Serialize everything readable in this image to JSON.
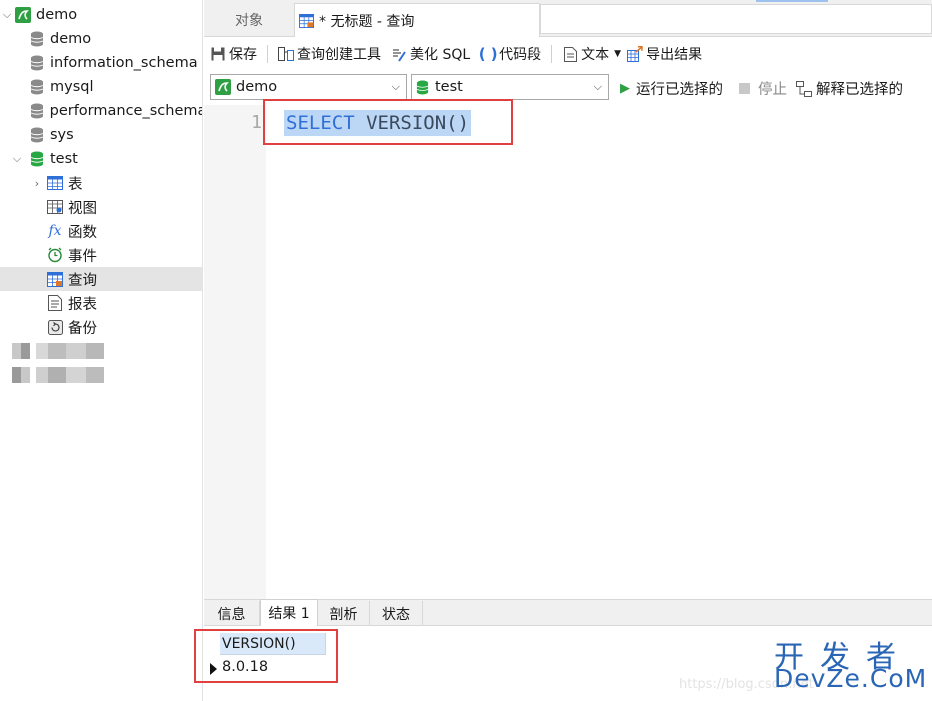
{
  "sidebar": {
    "connection": {
      "label": "demo"
    },
    "databases": [
      {
        "label": "demo"
      },
      {
        "label": "information_schema"
      },
      {
        "label": "mysql"
      },
      {
        "label": "performance_schema"
      },
      {
        "label": "sys"
      },
      {
        "label": "test"
      }
    ],
    "test_children": [
      {
        "label": "表",
        "icon": "table-icon"
      },
      {
        "label": "视图",
        "icon": "view-icon"
      },
      {
        "label": "函数",
        "icon": "function-icon"
      },
      {
        "label": "事件",
        "icon": "event-icon"
      },
      {
        "label": "查询",
        "icon": "query-icon",
        "selected": true
      },
      {
        "label": "报表",
        "icon": "report-icon"
      },
      {
        "label": "备份",
        "icon": "backup-icon"
      }
    ]
  },
  "tabs": {
    "objects": "对象",
    "query": "* 无标题 - 查询"
  },
  "toolbar": {
    "save": "保存",
    "query_builder": "查询创建工具",
    "beautify": "美化 SQL",
    "snippet": "代码段",
    "text": "文本",
    "export": "导出结果"
  },
  "connbar": {
    "connection": "demo",
    "database": "test",
    "run_selected": "运行已选择的",
    "stop": "停止",
    "explain_selected": "解释已选择的"
  },
  "editor": {
    "line_number": "1",
    "keyword": "SELECT",
    "function": "VERSION()"
  },
  "result_tabs": {
    "info": "信息",
    "result1": "结果 1",
    "profile": "剖析",
    "status": "状态"
  },
  "grid": {
    "column": "VERSION()",
    "value": "8.0.18"
  },
  "watermark": {
    "url": "https://blog.csdn.net",
    "brand_cn": "开发者",
    "brand_en": "DevZe.CoM"
  },
  "colors": {
    "mysql_green": "#2ea043",
    "db_green": "#27a844",
    "highlight_red": "#e04040",
    "selection_blue": "#bcd6f5",
    "keyword_blue": "#2f6fd8",
    "brand_blue": "#2a66b5"
  }
}
